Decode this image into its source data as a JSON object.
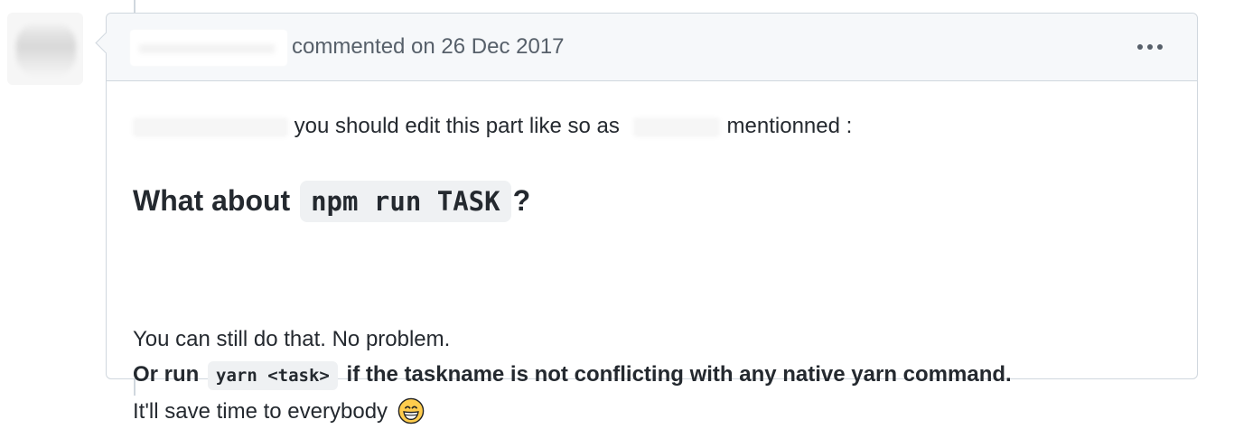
{
  "header": {
    "action_text": "commented on 26 Dec 2017",
    "more_icon": "kebab-horizontal-icon"
  },
  "body": {
    "line1": {
      "text_before_mention": "you should edit this part like so as",
      "text_after_mention": "mentionned :"
    },
    "heading": {
      "prefix": "What about",
      "code": "npm run TASK",
      "suffix": "?"
    },
    "paragraph": {
      "line1": "You can still do that. No problem.",
      "line2_prefix": "Or run",
      "line2_code": "yarn <task>",
      "line2_suffix": "if the taskname is not conflicting with any native yarn command.",
      "line3": "It'll save time to everybody",
      "emoji": "grinning-face-emoji"
    }
  },
  "colors": {
    "header_bg": "#f6f8fa",
    "border": "#d0d7de",
    "muted_text": "#57606a",
    "code_bg": "#eff1f3",
    "emoji_yellow": "#ffcc4d"
  }
}
